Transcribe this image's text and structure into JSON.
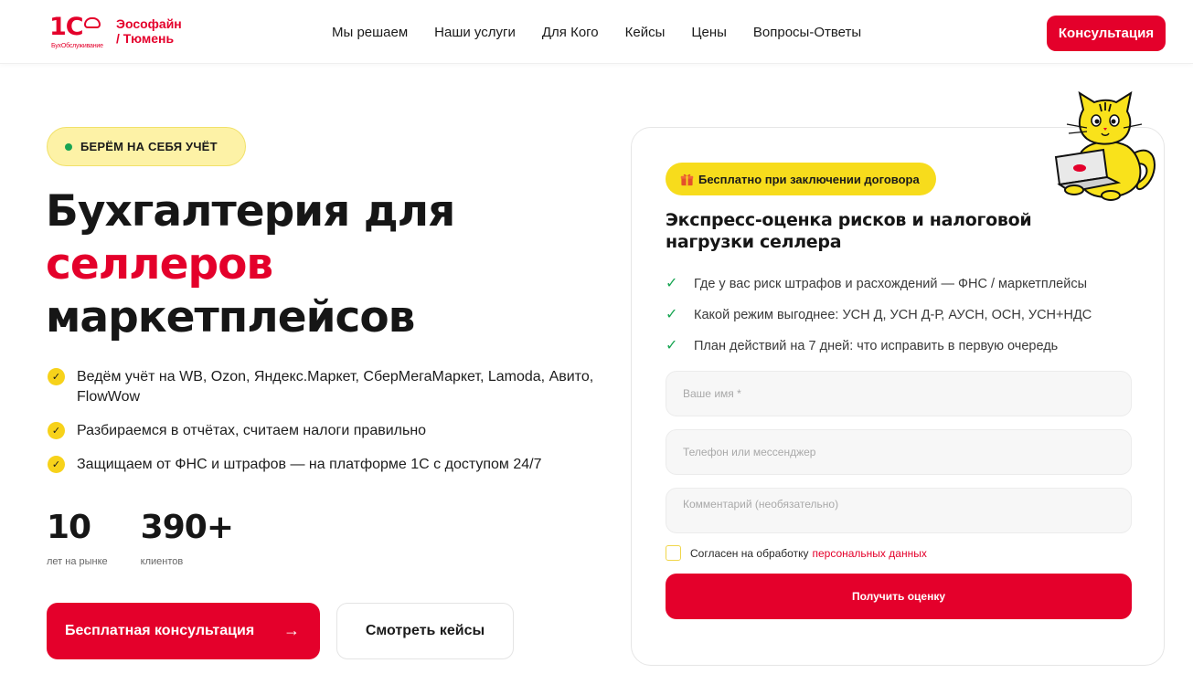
{
  "header": {
    "logo": {
      "mark": "1С",
      "mark_sub": "БухОбслуживание",
      "brand_line1": "Эософайн",
      "brand_line2": "/ Тюмень"
    },
    "nav": [
      "Мы решаем",
      "Наши услуги",
      "Для Кого",
      "Кейсы",
      "Цены",
      "Вопросы-Ответы"
    ],
    "cta_label": "Консультация"
  },
  "hero": {
    "pill": "БЕРЁМ НА СЕБЯ УЧЁТ",
    "title_line1": "Бухгалтерия для",
    "title_accent": "селлеров",
    "title_line3": "маркетплейсов",
    "features": [
      "Ведём учёт на WB, Ozon, Яндекс.Маркет, СберМегаМаркет, Lamoda, Авито, FlowWow",
      "Разбираемся в отчётах, считаем налоги правильно",
      "Защищаем от ФНС и штрафов — на платформе 1С с доступом 24/7"
    ],
    "stats": [
      {
        "value": "10",
        "label": "лет на рынке"
      },
      {
        "value": "390+",
        "label": "клиентов"
      }
    ],
    "primary_button": "Бесплатная консультация",
    "primary_arrow": "→",
    "secondary_button": "Смотреть кейсы"
  },
  "form": {
    "badge": "Бесплатно при заключении договора",
    "title": "Экспресс-оценка рисков и налоговой нагрузки селлера",
    "points": [
      "Где у вас риск штрафов и расхождений — ФНС / маркетплейсы",
      "Какой режим выгоднее: УСН Д, УСН Д-Р, АУСН, ОСН, УСН+НДС",
      "План действий на 7 дней: что исправить в первую очередь"
    ],
    "name_placeholder": "Ваше имя *",
    "contact_placeholder": "Телефон или мессенджер",
    "comment_placeholder": "Комментарий (необязательно)",
    "consent_text": "Согласен на обработку",
    "consent_link": "персональных данных",
    "submit_label": "Получить оценку"
  },
  "icons": {
    "check_mark": "✓",
    "feature_check": "✓"
  },
  "colors": {
    "accent": "#e4002b",
    "yellow": "#f7dc1c",
    "green": "#19a553"
  }
}
